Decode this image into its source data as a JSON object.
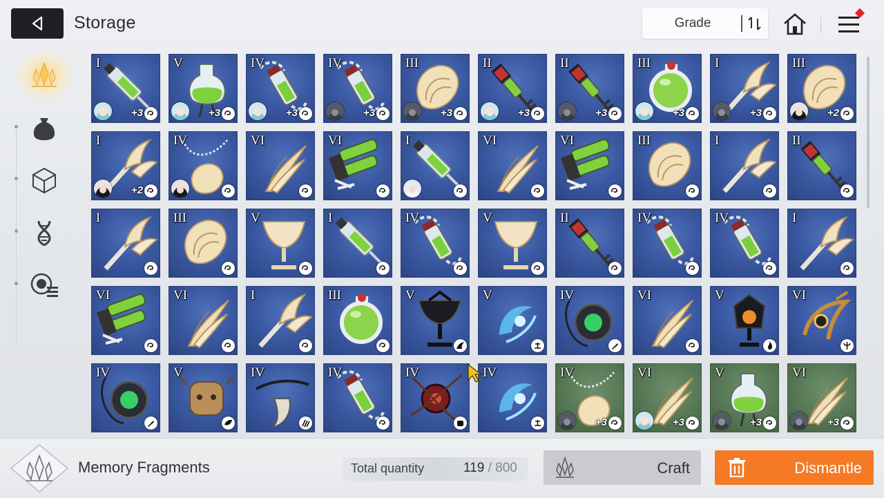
{
  "header": {
    "title": "Storage",
    "sort_label": "Grade"
  },
  "sidebar": {
    "items": [
      {
        "name": "memory-fragments",
        "icon": "crystal-icon",
        "active": true
      },
      {
        "name": "materials",
        "icon": "pouch-icon",
        "active": false
      },
      {
        "name": "items",
        "icon": "cube-icon",
        "active": false
      },
      {
        "name": "genes",
        "icon": "dna-icon",
        "active": false
      },
      {
        "name": "other",
        "icon": "list-badge-icon",
        "active": false
      }
    ]
  },
  "grid": {
    "cards": [
      {
        "rank": "I",
        "art": "syringe",
        "bg": "blue",
        "avatar": "teal",
        "plus": "+3",
        "set": "swirl"
      },
      {
        "rank": "V",
        "art": "flask",
        "bg": "blue",
        "avatar": "teal",
        "plus": "+3",
        "set": "swirl"
      },
      {
        "rank": "IV",
        "art": "vial",
        "bg": "blue",
        "avatar": "teal",
        "plus": "+3",
        "set": "swirl"
      },
      {
        "rank": "IV",
        "art": "vial",
        "bg": "blue",
        "avatar": "gray",
        "plus": "+3",
        "set": "swirl"
      },
      {
        "rank": "III",
        "art": "shell",
        "bg": "blue",
        "avatar": "gray",
        "plus": "+3",
        "set": "swirl"
      },
      {
        "rank": "II",
        "art": "key",
        "bg": "blue",
        "avatar": "teal",
        "plus": "+3",
        "set": "swirl"
      },
      {
        "rank": "II",
        "art": "key",
        "bg": "blue",
        "avatar": "gray",
        "plus": "+3",
        "set": "swirl"
      },
      {
        "rank": "III",
        "art": "orb",
        "bg": "blue",
        "avatar": "teal",
        "plus": "+3",
        "set": "swirl"
      },
      {
        "rank": "I",
        "art": "trident",
        "bg": "blue",
        "avatar": "gray",
        "plus": "+3",
        "set": "swirl"
      },
      {
        "rank": "III",
        "art": "shell",
        "bg": "blue",
        "avatar": "dark",
        "plus": "+2",
        "set": "swirl"
      },
      {
        "rank": "I",
        "art": "trident",
        "bg": "blue",
        "avatar": "dark",
        "plus": "+2",
        "set": "swirl"
      },
      {
        "rank": "IV",
        "art": "pendant",
        "bg": "blue",
        "avatar": "dark",
        "plus": "",
        "set": "swirl"
      },
      {
        "rank": "VI",
        "art": "feather",
        "bg": "blue",
        "avatar": "",
        "plus": "",
        "set": "swirl"
      },
      {
        "rank": "VI",
        "art": "injector",
        "bg": "blue",
        "avatar": "",
        "plus": "",
        "set": "swirl"
      },
      {
        "rank": "I",
        "art": "syringe",
        "bg": "blue",
        "avatar": "white",
        "plus": "",
        "set": "swirl"
      },
      {
        "rank": "VI",
        "art": "feather",
        "bg": "blue",
        "avatar": "",
        "plus": "",
        "set": "swirl"
      },
      {
        "rank": "VI",
        "art": "injector",
        "bg": "blue",
        "avatar": "",
        "plus": "",
        "set": "swirl"
      },
      {
        "rank": "III",
        "art": "shell",
        "bg": "blue",
        "avatar": "",
        "plus": "",
        "set": "swirl"
      },
      {
        "rank": "I",
        "art": "trident",
        "bg": "blue",
        "avatar": "",
        "plus": "",
        "set": "swirl"
      },
      {
        "rank": "II",
        "art": "key",
        "bg": "blue",
        "avatar": "",
        "plus": "",
        "set": "swirl"
      },
      {
        "rank": "I",
        "art": "trident",
        "bg": "blue",
        "avatar": "",
        "plus": "",
        "set": "swirl"
      },
      {
        "rank": "III",
        "art": "shell",
        "bg": "blue",
        "avatar": "",
        "plus": "",
        "set": "swirl"
      },
      {
        "rank": "V",
        "art": "chalice",
        "bg": "blue",
        "avatar": "",
        "plus": "",
        "set": "swirl"
      },
      {
        "rank": "I",
        "art": "syringe",
        "bg": "blue",
        "avatar": "",
        "plus": "",
        "set": "swirl"
      },
      {
        "rank": "IV",
        "art": "vial",
        "bg": "blue",
        "avatar": "",
        "plus": "",
        "set": "swirl"
      },
      {
        "rank": "V",
        "art": "chalice",
        "bg": "blue",
        "avatar": "",
        "plus": "",
        "set": "swirl"
      },
      {
        "rank": "II",
        "art": "key",
        "bg": "blue",
        "avatar": "",
        "plus": "",
        "set": "swirl"
      },
      {
        "rank": "IV",
        "art": "vial",
        "bg": "blue",
        "avatar": "",
        "plus": "",
        "set": "swirl"
      },
      {
        "rank": "IV",
        "art": "vial",
        "bg": "blue",
        "avatar": "",
        "plus": "",
        "set": "swirl"
      },
      {
        "rank": "I",
        "art": "trident",
        "bg": "blue",
        "avatar": "",
        "plus": "",
        "set": "swirl"
      },
      {
        "rank": "VI",
        "art": "injector",
        "bg": "blue",
        "avatar": "",
        "plus": "",
        "set": "swirl"
      },
      {
        "rank": "VI",
        "art": "feather",
        "bg": "blue",
        "avatar": "",
        "plus": "",
        "set": "swirl"
      },
      {
        "rank": "I",
        "art": "trident",
        "bg": "blue",
        "avatar": "",
        "plus": "",
        "set": "swirl"
      },
      {
        "rank": "III",
        "art": "orb",
        "bg": "blue",
        "avatar": "",
        "plus": "",
        "set": "swirl"
      },
      {
        "rank": "V",
        "art": "darkcup",
        "bg": "blue",
        "avatar": "",
        "plus": "",
        "set": "wing"
      },
      {
        "rank": "V",
        "art": "crystal",
        "bg": "blue",
        "avatar": "",
        "plus": "",
        "set": "scale"
      },
      {
        "rank": "IV",
        "art": "device",
        "bg": "blue",
        "avatar": "",
        "plus": "",
        "set": "pen"
      },
      {
        "rank": "VI",
        "art": "feather",
        "bg": "blue",
        "avatar": "",
        "plus": "",
        "set": "swirl"
      },
      {
        "rank": "V",
        "art": "lantern",
        "bg": "blue",
        "avatar": "",
        "plus": "",
        "set": "flame"
      },
      {
        "rank": "VI",
        "art": "crest",
        "bg": "blue",
        "avatar": "",
        "plus": "",
        "set": "trident"
      },
      {
        "rank": "IV",
        "art": "device",
        "bg": "blue",
        "avatar": "",
        "plus": "",
        "set": "pen"
      },
      {
        "rank": "V",
        "art": "doll",
        "bg": "blue",
        "avatar": "",
        "plus": "",
        "set": "leaf"
      },
      {
        "rank": "IV",
        "art": "claw",
        "bg": "blue",
        "avatar": "",
        "plus": "",
        "set": "claw"
      },
      {
        "rank": "IV",
        "art": "vial",
        "bg": "blue",
        "avatar": "",
        "plus": "",
        "set": "swirl"
      },
      {
        "rank": "IV",
        "art": "cord",
        "bg": "blue",
        "avatar": "",
        "plus": "",
        "set": "fist"
      },
      {
        "rank": "IV",
        "art": "crystal",
        "bg": "blue",
        "avatar": "",
        "plus": "",
        "set": "scale"
      },
      {
        "rank": "IV",
        "art": "pendant",
        "bg": "green",
        "avatar": "gray",
        "plus": "+3",
        "set": "swirl"
      },
      {
        "rank": "VI",
        "art": "feather",
        "bg": "green",
        "avatar": "teal",
        "plus": "+3",
        "set": "swirl"
      },
      {
        "rank": "V",
        "art": "flask",
        "bg": "green",
        "avatar": "gray",
        "plus": "+3",
        "set": "swirl"
      },
      {
        "rank": "VI",
        "art": "feather",
        "bg": "green",
        "avatar": "gray",
        "plus": "+3",
        "set": "swirl"
      }
    ]
  },
  "footer": {
    "category_label": "Memory Fragments",
    "total_label": "Total quantity",
    "total_current": "119",
    "total_separator": " / ",
    "total_max": "800",
    "craft_label": "Craft",
    "dismantle_label": "Dismantle"
  },
  "colors": {
    "accent": "#f47a25",
    "card_blue": "#3b5aa3",
    "card_green": "#587956",
    "dark_button": "#1f2024"
  }
}
